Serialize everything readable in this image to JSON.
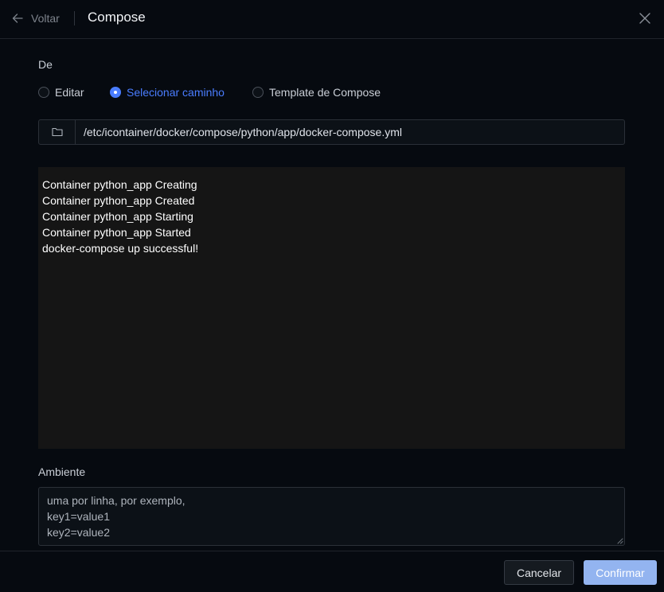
{
  "header": {
    "back_label": "Voltar",
    "title": "Compose",
    "icons": {
      "back": "arrow-left-icon",
      "close": "close-icon"
    }
  },
  "source": {
    "label": "De",
    "options": [
      {
        "label": "Editar",
        "checked": false
      },
      {
        "label": "Selecionar caminho",
        "checked": true
      },
      {
        "label": "Template de Compose",
        "checked": false
      }
    ],
    "path_value": "/etc/icontainer/docker/compose/python/app/docker-compose.yml",
    "folder_icon": "folder-icon"
  },
  "log": {
    "lines": [
      "Container python_app Creating",
      "Container python_app Created",
      "Container python_app Starting",
      "Container python_app Started",
      "docker-compose up successful!"
    ]
  },
  "environment": {
    "label": "Ambiente",
    "placeholder_lines": [
      "uma por linha, por exemplo,",
      "key1=value1",
      "key2=value2"
    ]
  },
  "footer": {
    "cancel_label": "Cancelar",
    "confirm_label": "Confirmar"
  },
  "colors": {
    "background": "#060a10",
    "accent": "#4a7dff",
    "confirm_button": "#93b4f0",
    "log_background": "#151515"
  }
}
